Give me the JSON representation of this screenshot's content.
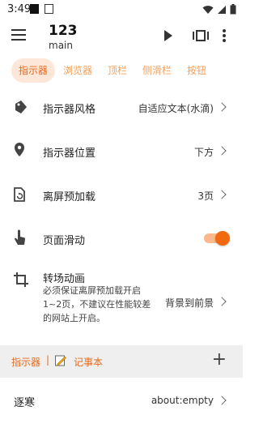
{
  "status": {
    "time": "3:49"
  },
  "app": {
    "title": "123",
    "subtitle": "main"
  },
  "tabs": [
    {
      "label": "指示器",
      "active": true
    },
    {
      "label": "浏览器",
      "active": false
    },
    {
      "label": "顶栏",
      "active": false
    },
    {
      "label": "侧滑栏",
      "active": false
    },
    {
      "label": "按钮",
      "active": false
    }
  ],
  "settings": [
    {
      "icon": "label-tag-icon",
      "label": "指示器风格",
      "value": "自适应文本(水滴)"
    },
    {
      "icon": "location-pin-icon",
      "label": "指示器位置",
      "value": "下方"
    },
    {
      "icon": "preload-page-icon",
      "label": "离屏预加载",
      "value": "3页"
    },
    {
      "icon": "touch-hand-icon",
      "label": "页面滑动",
      "toggle_on": true
    },
    {
      "icon": "crop-icon",
      "label": "转场动画",
      "description": "必须保证离屏预加载开启1~2页，不建议在性能较差的网站上开启。",
      "value": "背景到前景"
    }
  ],
  "group_bar": {
    "left_label": "指示器",
    "separator": "|",
    "right_label": "记事本",
    "add_symbol": "+"
  },
  "list": [
    {
      "label": "逐寒",
      "value": "about:empty"
    }
  ],
  "colors": {
    "accent": "#E56A1E",
    "accent_light": "#FDE7D8",
    "toggle_on": "#F26A10",
    "group_bg": "#EFEFEF"
  }
}
